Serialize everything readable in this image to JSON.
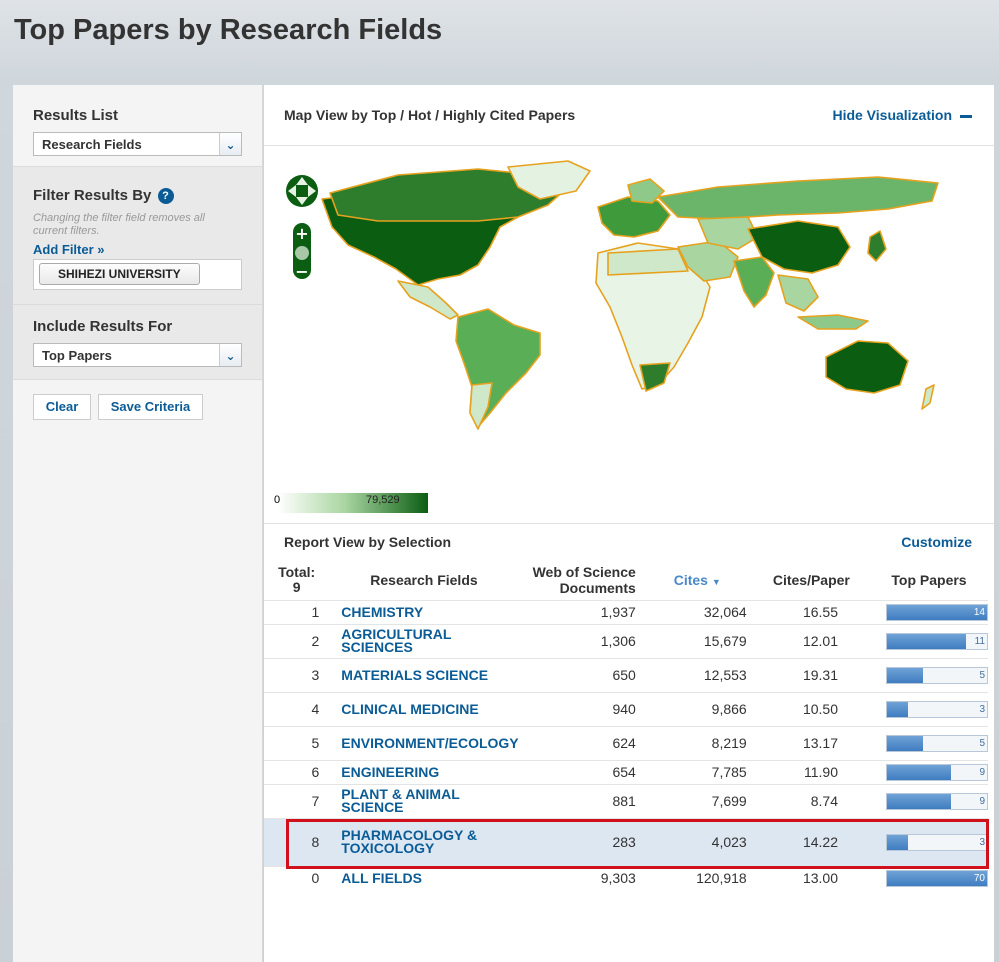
{
  "page": {
    "title": "Top Papers by Research Fields"
  },
  "sidebar": {
    "results_list_label": "Results List",
    "results_list_value": "Research Fields",
    "filter_label": "Filter Results By",
    "filter_help": "?",
    "filter_note": "Changing the filter field removes all current filters.",
    "add_filter": "Add Filter »",
    "filter_chip": "SHIHEZI UNIVERSITY",
    "include_label": "Include Results For",
    "include_value": "Top Papers",
    "clear_button": "Clear",
    "save_button": "Save Criteria"
  },
  "map": {
    "header": "Map View by Top / Hot / Highly Cited Papers",
    "hide_label": "Hide Visualization",
    "legend_min": "0",
    "legend_max": "79,529",
    "colors": {
      "low": "#ffffff",
      "mid": "#6bb56a",
      "high": "#0b5d12",
      "border": "#e6a21e"
    }
  },
  "report": {
    "title": "Report View by Selection",
    "customize": "Customize",
    "columns": {
      "total": "Total:",
      "total_count": "9",
      "field": "Research Fields",
      "docs": "Web of Science Documents",
      "cites": "Cites",
      "cites_per": "Cites/Paper",
      "top": "Top Papers"
    },
    "rows": [
      {
        "rank": "1",
        "field": "CHEMISTRY",
        "docs": "1,937",
        "cites": "32,064",
        "cpp": "16.55",
        "top": "14",
        "top_frac": 1.0
      },
      {
        "rank": "2",
        "field": "AGRICULTURAL SCIENCES",
        "docs": "1,306",
        "cites": "15,679",
        "cpp": "12.01",
        "top": "11",
        "top_frac": 0.79
      },
      {
        "rank": "3",
        "field": "MATERIALS SCIENCE",
        "docs": "650",
        "cites": "12,553",
        "cpp": "19.31",
        "top": "5",
        "top_frac": 0.36
      },
      {
        "rank": "4",
        "field": "CLINICAL MEDICINE",
        "docs": "940",
        "cites": "9,866",
        "cpp": "10.50",
        "top": "3",
        "top_frac": 0.21
      },
      {
        "rank": "5",
        "field": "ENVIRONMENT/ECOLOGY",
        "docs": "624",
        "cites": "8,219",
        "cpp": "13.17",
        "top": "5",
        "top_frac": 0.36
      },
      {
        "rank": "6",
        "field": "ENGINEERING",
        "docs": "654",
        "cites": "7,785",
        "cpp": "11.90",
        "top": "9",
        "top_frac": 0.64
      },
      {
        "rank": "7",
        "field": "PLANT & ANIMAL SCIENCE",
        "docs": "881",
        "cites": "7,699",
        "cpp": "8.74",
        "top": "9",
        "top_frac": 0.64
      },
      {
        "rank": "8",
        "field": "PHARMACOLOGY & TOXICOLOGY",
        "docs": "283",
        "cites": "4,023",
        "cpp": "14.22",
        "top": "3",
        "top_frac": 0.21
      },
      {
        "rank": "0",
        "field": "ALL FIELDS",
        "docs": "9,303",
        "cites": "120,918",
        "cpp": "13.00",
        "top": "70",
        "top_frac": 1.0
      }
    ]
  }
}
